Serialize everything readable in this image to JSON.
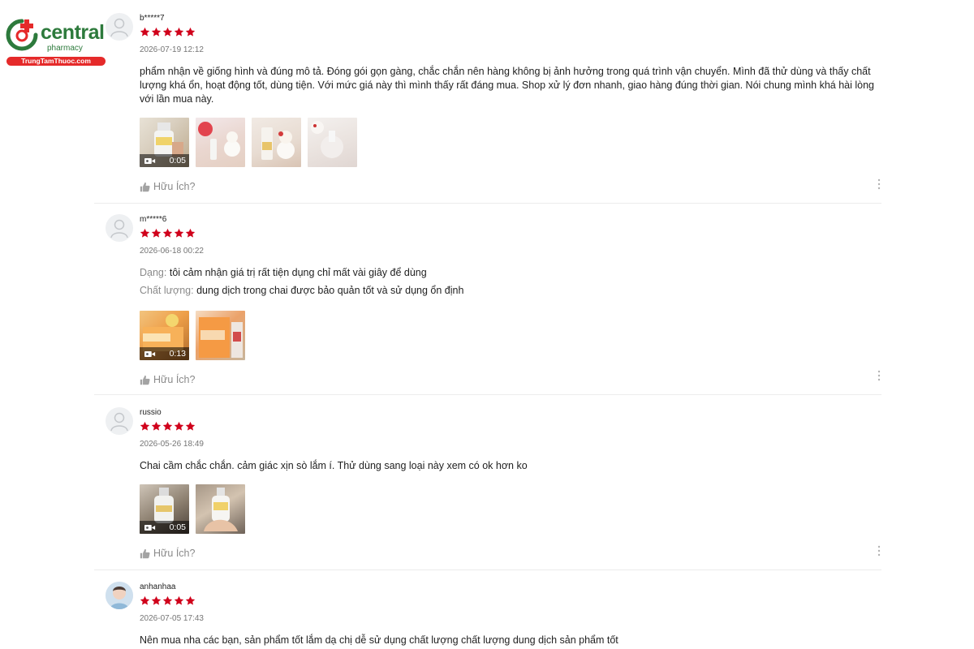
{
  "brand": {
    "name": "central",
    "sub": "pharmacy",
    "url": "TrungTamThuoc.com",
    "colors": {
      "green": "#2d7a3c",
      "red": "#e52a2a"
    }
  },
  "colors": {
    "star": "#d0011b",
    "muted": "#757575"
  },
  "reviews": [
    {
      "username": "b*****7",
      "rating": 5,
      "date": "2026-07-19 12:12",
      "text": "phẩm nhận về giống hình và đúng mô tả. Đóng gói gọn gàng, chắc chắn nên hàng không bị ảnh hưởng trong quá trình vận chuyển. Mình đã thử dùng và thấy chất lượng khá ổn, hoạt động tốt, dùng tiện. Với mức giá này thì mình thấy rất đáng mua. Shop xử lý đơn nhanh, giao hàng đúng thời gian. Nói chung mình khá hài lòng với lần mua này.",
      "video_duration": "0:05",
      "helpful_label": "Hữu Ích?"
    },
    {
      "username": "m*****6",
      "rating": 5,
      "date": "2026-06-18 00:22",
      "fields": [
        {
          "label": "Dạng:",
          "value": "tôi cảm nhận giá trị rất tiện dụng chỉ mất vài giây để dùng"
        },
        {
          "label": "Chất lượng:",
          "value": "dung dịch trong chai được bảo quản tốt và sử dụng ổn định"
        }
      ],
      "video_duration": "0:13",
      "helpful_label": "Hữu Ích?"
    },
    {
      "username": "russio",
      "rating": 5,
      "date": "2026-05-26 18:49",
      "text": "Chai cầm chắc chắn. cảm giác xịn sò lắm í. Thử dùng sang loại này xem có ok hơn ko",
      "video_duration": "0:05",
      "helpful_label": "Hữu Ích?"
    },
    {
      "username": "anhanhaa",
      "rating": 5,
      "date": "2026-07-05 17:43",
      "text": "Nên mua nha các bạn, sản phẩm tốt lắm dạ chị dễ sử dụng chất lượng chất lượng dung dịch sản phẩm tốt"
    }
  ]
}
